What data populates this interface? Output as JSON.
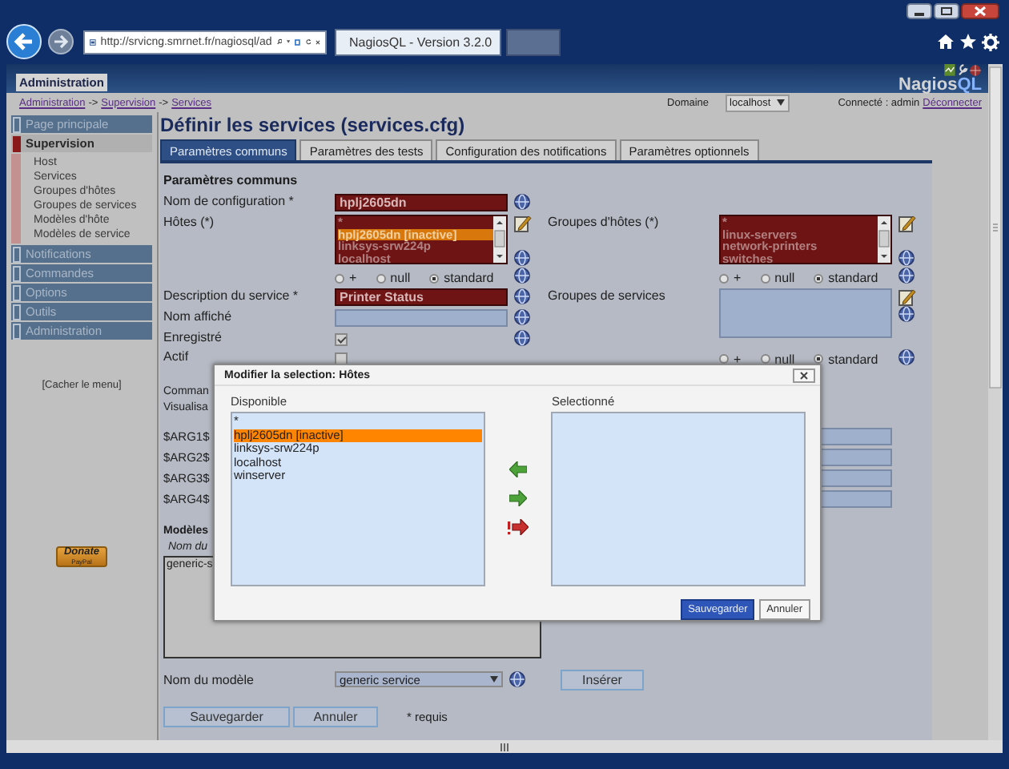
{
  "browser": {
    "address": "http://srvicng.smrnet.fr/nagiosql/ad",
    "tabs": [
      {
        "title": "NagiosQL - Version 3.2.0",
        "selected": true
      }
    ]
  },
  "header": {
    "section_tab": "Administration",
    "logo": {
      "prefix": "Nagios",
      "suffix": "QL"
    }
  },
  "breadcrumb": {
    "links": [
      "Administration",
      "Supervision",
      "Services"
    ],
    "separator": "->"
  },
  "domain": {
    "label": "Domaine",
    "value": "localhost"
  },
  "session": {
    "text": "Connecté : admin",
    "logout": "Déconnecter"
  },
  "sidebar": {
    "items": [
      {
        "label": "Page principale",
        "expanded": false
      },
      {
        "label": "Supervision",
        "expanded": true,
        "children": [
          {
            "label": "Host"
          },
          {
            "label": "Services"
          },
          {
            "label": "Groupes d'hôtes"
          },
          {
            "label": "Groupes de services"
          },
          {
            "label": "Modèles d'hôte"
          },
          {
            "label": "Modèles de service"
          }
        ]
      },
      {
        "label": "Notifications",
        "expanded": false
      },
      {
        "label": "Commandes",
        "expanded": false
      },
      {
        "label": "Options",
        "expanded": false
      },
      {
        "label": "Outils",
        "expanded": false
      },
      {
        "label": "Administration",
        "expanded": false
      }
    ],
    "hide_menu": "[Cacher le menu]",
    "donate": {
      "label": "Donate",
      "sub": "PayPal"
    }
  },
  "page": {
    "title": "Définir les services (services.cfg)",
    "tabs": [
      {
        "label": "Paramètres communs",
        "selected": true
      },
      {
        "label": "Paramètres des tests",
        "selected": false
      },
      {
        "label": "Configuration des notifications",
        "selected": false
      },
      {
        "label": "Paramètres optionnels",
        "selected": false
      }
    ]
  },
  "form": {
    "section": "Paramètres communs",
    "config_name": {
      "label": "Nom de configuration *",
      "value": "hplj2605dn"
    },
    "hosts": {
      "label": "Hôtes (*)",
      "options": [
        {
          "label": "*",
          "selected": false
        },
        {
          "label": "hplj2605dn [inactive]",
          "selected": true
        },
        {
          "label": "linksys-srw224p",
          "selected": false
        },
        {
          "label": "localhost",
          "selected": false
        }
      ],
      "radios": [
        {
          "label": "+",
          "selected": false
        },
        {
          "label": "null",
          "selected": false
        },
        {
          "label": "standard",
          "selected": true
        }
      ]
    },
    "host_groups": {
      "label": "Groupes d'hôtes (*)",
      "options": [
        {
          "label": "*",
          "selected": false
        },
        {
          "label": "linux-servers",
          "selected": false
        },
        {
          "label": "network-printers",
          "selected": false
        },
        {
          "label": "switches",
          "selected": false
        }
      ],
      "radios": [
        {
          "label": "+",
          "selected": false
        },
        {
          "label": "null",
          "selected": false
        },
        {
          "label": "standard",
          "selected": true
        }
      ]
    },
    "description": {
      "label": "Description du service *",
      "value": "Printer Status"
    },
    "display_name": {
      "label": "Nom affiché"
    },
    "service_groups": {
      "label": "Groupes de services",
      "radios": [
        {
          "label": "+",
          "selected": false
        },
        {
          "label": "null",
          "selected": false
        },
        {
          "label": "standard",
          "selected": true
        }
      ]
    },
    "registered": {
      "label": "Enregistré",
      "checked": true
    },
    "active": {
      "label": "Actif",
      "checked": false
    },
    "command_labels": [
      "Comman",
      "Visualisa"
    ],
    "args": [
      "$ARG1$",
      "$ARG2$",
      "$ARG3$",
      "$ARG4$"
    ],
    "templates": {
      "heading": "Modèles",
      "column": "Nom du",
      "rows": [
        "generic-s"
      ],
      "template_label": "Nom du modèle",
      "template_value": "generic service",
      "insert": "Insérer"
    },
    "buttons": [
      "Sauvegarder",
      "Annuler"
    ],
    "required_note": "* requis"
  },
  "dialog": {
    "title": "Modifier la selection: Hôtes",
    "available": {
      "label": "Disponible",
      "options": [
        {
          "label": "*",
          "selected": false
        },
        {
          "label": "hplj2605dn [inactive]",
          "selected": true
        },
        {
          "label": "linksys-srw224p",
          "selected": false
        },
        {
          "label": "localhost",
          "selected": false
        },
        {
          "label": "winserver",
          "selected": false
        }
      ]
    },
    "chosen": {
      "label": "Selectionné"
    },
    "buttons": [
      {
        "label": "Sauvegarder",
        "kind": "primary"
      },
      {
        "label": "Annuler",
        "kind": "secondary"
      }
    ]
  }
}
